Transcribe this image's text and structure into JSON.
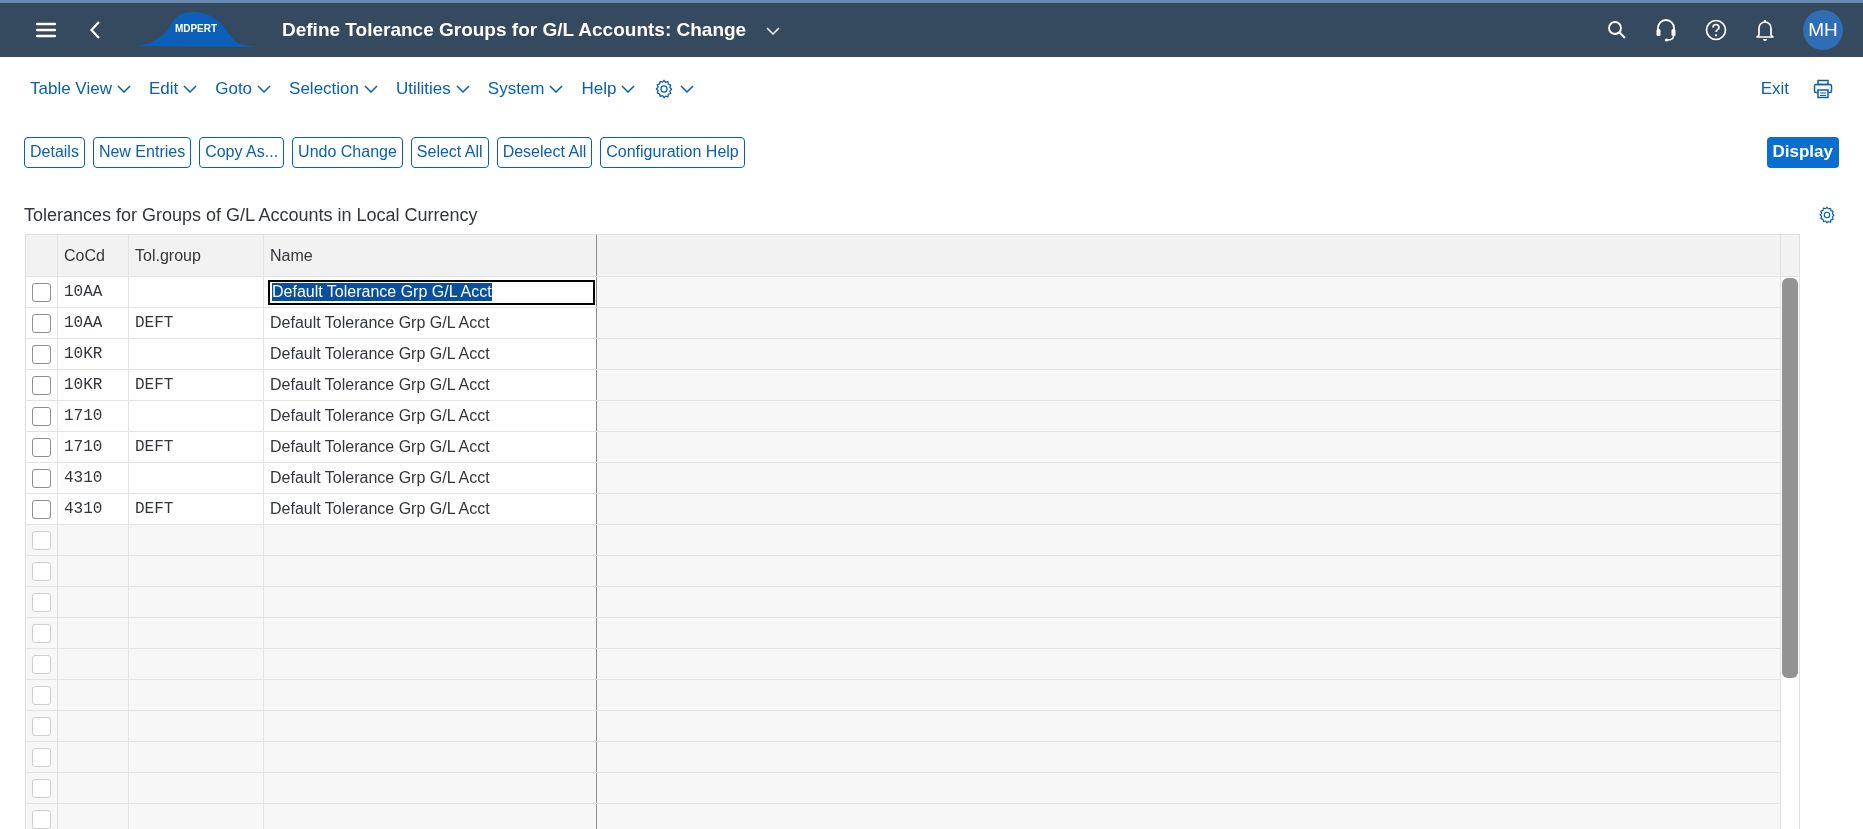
{
  "header": {
    "title": "Define Tolerance Groups for G/L Accounts: Change",
    "logo_text": "MDPERT",
    "avatar_initials": "MH"
  },
  "menu": [
    {
      "label": "Table View"
    },
    {
      "label": "Edit"
    },
    {
      "label": "Goto"
    },
    {
      "label": "Selection"
    },
    {
      "label": "Utilities"
    },
    {
      "label": "System"
    },
    {
      "label": "Help"
    }
  ],
  "exit_link": "Exit",
  "toolbar_buttons": [
    "Details",
    "New Entries",
    "Copy As...",
    "Undo Change",
    "Select All",
    "Deselect All",
    "Configuration Help"
  ],
  "display_button": "Display",
  "table": {
    "title": "Tolerances for Groups of G/L Accounts in Local Currency",
    "columns": [
      "CoCd",
      "Tol.group",
      "Name"
    ],
    "rows": [
      {
        "cocd": "10AA",
        "name": "Default Tolerance Grp G/L Acct",
        "checked": false,
        "focused": true
      },
      {
        "cocd": "10AA",
        "tol_group": "DEFT",
        "name": "Default Tolerance Grp G/L Acct",
        "checked": false,
        "focused": false
      },
      {
        "cocd": "10KR",
        "name": "Default Tolerance Grp G/L Acct",
        "checked": false,
        "focused": false
      },
      {
        "cocd": "10KR",
        "tol_group": "DEFT",
        "name": "Default Tolerance Grp G/L Acct",
        "checked": false,
        "focused": false
      },
      {
        "cocd": "1710",
        "name": "Default Tolerance Grp G/L Acct",
        "checked": false,
        "focused": false
      },
      {
        "cocd": "1710",
        "tol_group": "DEFT",
        "name": "Default Tolerance Grp G/L Acct",
        "checked": false,
        "focused": false
      },
      {
        "cocd": "4310",
        "name": "Default Tolerance Grp G/L Acct",
        "checked": false,
        "focused": false
      },
      {
        "cocd": "4310",
        "tol_group": "DEFT",
        "name": "Default Tolerance Grp G/L Acct",
        "checked": false,
        "focused": false
      }
    ],
    "blank_rows": [
      {
        "checked": false
      },
      {
        "checked": false
      },
      {
        "checked": false
      },
      {
        "checked": false
      },
      {
        "checked": false
      },
      {
        "checked": false
      },
      {
        "checked": false
      },
      {
        "checked": false
      },
      {
        "checked": false
      },
      {
        "checked": false
      }
    ]
  }
}
